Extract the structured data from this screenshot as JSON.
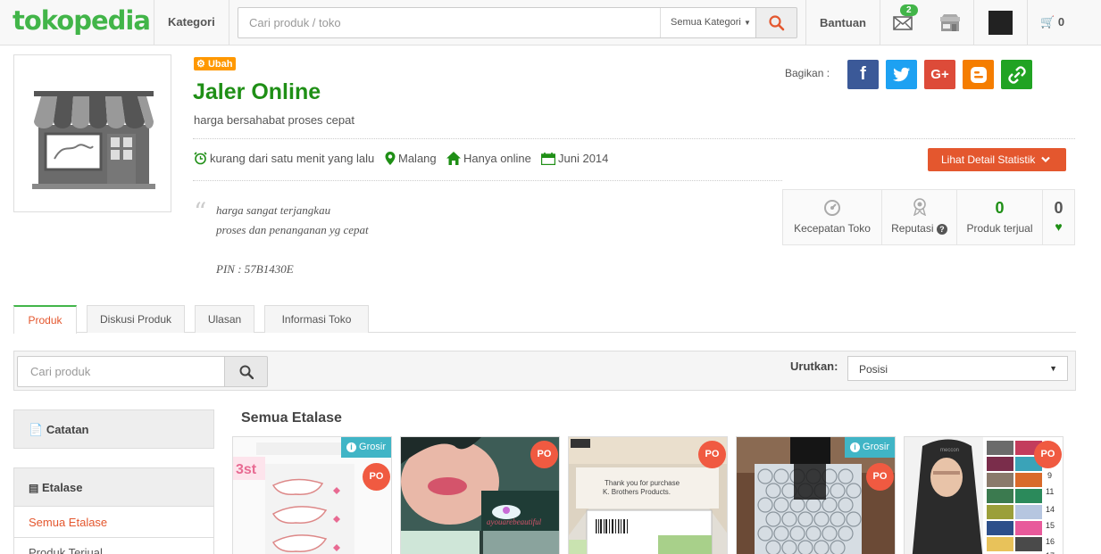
{
  "header": {
    "logo": "tokopedia",
    "kategori": "Kategori",
    "search_placeholder": "Cari produk / toko",
    "search_category": "Semua Kategori",
    "bantuan": "Bantuan",
    "message_count": "2",
    "cart_count": "0"
  },
  "shop": {
    "edit_label": "Ubah",
    "name": "Jaler Online",
    "tagline": "harga bersahabat proses cepat",
    "last_online": "kurang dari satu menit yang lalu",
    "location": "Malang",
    "store_type": "Hanya online",
    "joined": "Juni 2014",
    "detail_button": "Lihat Detail Statistik",
    "share_label": "Bagikan :",
    "description": [
      "harga sangat terjangkau",
      "proses dan penanganan yg cepat",
      "",
      "PIN : 57B1430E"
    ],
    "stats": {
      "kecepatan_label": "Kecepatan Toko",
      "reputasi_label": "Reputasi",
      "produk_terjual_value": "0",
      "produk_terjual_label": "Produk terjual",
      "favorit_value": "0"
    }
  },
  "tabs": [
    "Produk",
    "Diskusi Produk",
    "Ulasan",
    "Informasi Toko"
  ],
  "filter": {
    "search_placeholder": "Cari produk",
    "sort_label": "Urutkan:",
    "sort_value": "Posisi"
  },
  "sidebar": {
    "catatan": "Catatan",
    "etalase": "Etalase",
    "items": [
      "Semua Etalase",
      "Produk Terjual"
    ]
  },
  "products": {
    "section_title": "Semua Etalase",
    "po_label": "PO",
    "grosir_label": "Grosir",
    "card2_text": "Thank you for purchase K. Brothers Products"
  },
  "colors": {
    "brand_green": "#42b549",
    "shop_name": "#1f8f16",
    "accent_orange": "#e4572e",
    "facebook": "#3b5998",
    "twitter": "#1da1f2",
    "google_plus": "#dd4b39",
    "blogger": "#f57d00",
    "link": "#21a323"
  }
}
